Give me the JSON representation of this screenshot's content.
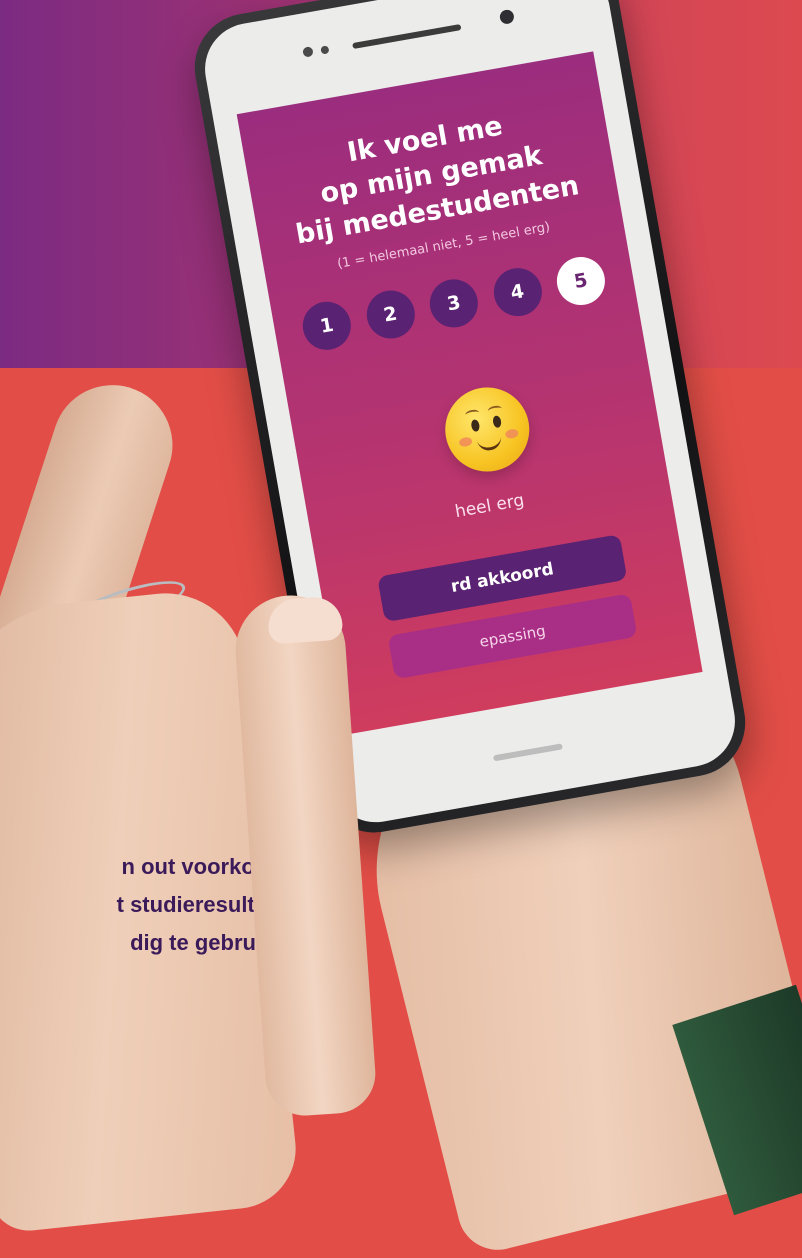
{
  "survey": {
    "title_lines": [
      "Ik voel me",
      "op mijn gemak",
      "bij medestudenten"
    ],
    "hint": "(1 = helemaal niet, 5 = heel erg)",
    "scale": [
      "1",
      "2",
      "3",
      "4",
      "5"
    ],
    "selected": "5",
    "answer_label": "heel erg",
    "primary_button": "rd akkoord",
    "secondary_button": "epassing"
  },
  "caption": {
    "lines": [
      "n out voorkomen",
      "t studieresultaten",
      "dig te gebruiken"
    ]
  },
  "colors": {
    "accent_dark": "#5a2272",
    "screen_top": "#9b2d7e",
    "screen_bottom": "#cf3c5e",
    "background": "#e24e47"
  },
  "icons": {
    "emoji": "smiling-face-with-blush-icon"
  }
}
